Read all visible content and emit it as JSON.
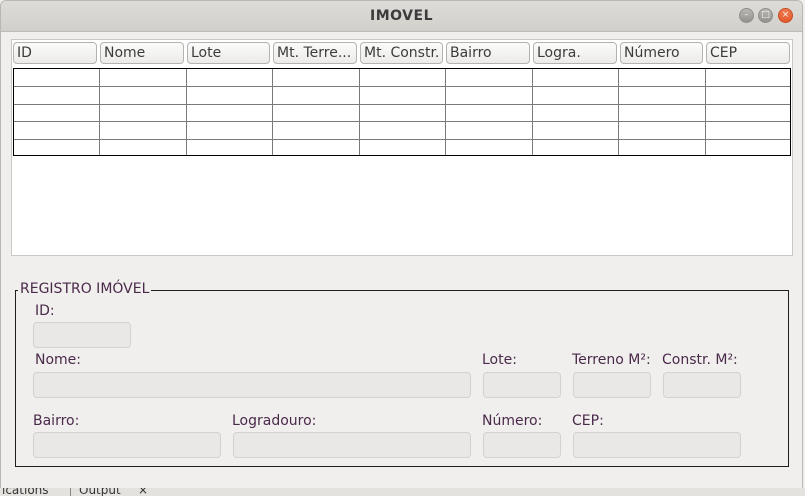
{
  "window": {
    "title": "IMOVEL"
  },
  "table": {
    "columns": [
      "ID",
      "Nome",
      "Lote",
      "Mt. Terre...",
      "Mt. Constr.",
      "Bairro",
      "Logra.",
      "Número",
      "CEP"
    ]
  },
  "form": {
    "legend": "REGISTRO IMÓVEL",
    "labels": {
      "id": "ID:",
      "nome": "Nome:",
      "lote": "Lote:",
      "terreno": "Terreno M²:",
      "constr": "Constr. M²:",
      "bairro": "Bairro:",
      "logradouro": "Logradouro:",
      "numero": "Número:",
      "cep": "CEP:"
    },
    "values": {
      "id": "",
      "nome": "",
      "lote": "",
      "terreno": "",
      "constr": "",
      "bairro": "",
      "logradouro": "",
      "numero": "",
      "cep": ""
    }
  },
  "background": {
    "tab1": "ications",
    "tab2": "Output",
    "tab2_close": "×"
  }
}
